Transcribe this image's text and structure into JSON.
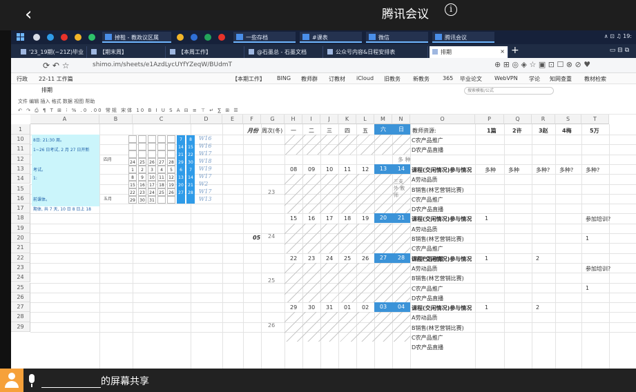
{
  "meeting": {
    "back_glyph": "‹",
    "title": "腾讯会议",
    "info_glyph": "i",
    "sharer_blank": "",
    "share_suffix": "的屏幕共享"
  },
  "taskbar": {
    "apps": [
      {
        "label": "掉鞋 - 教政议区属",
        "color": "#4a8ee8"
      },
      {
        "label": "一些存档",
        "color": "#f0b429"
      },
      {
        "label": "#课表",
        "color": "#f0b429"
      },
      {
        "label": "微信",
        "color": "#2ec26a"
      },
      {
        "label": "腾讯会议",
        "color": "#4a8ee8"
      }
    ],
    "tray_text": "∧ ⊡ ♫ 19:"
  },
  "browser": {
    "tabs": [
      {
        "label": "'23_19期(~21Z)毕业"
      },
      {
        "label": "【期末周】"
      },
      {
        "label": "【本周工作】"
      },
      {
        "label": "@石墨总 - 石墨文档"
      },
      {
        "label": "公众号内容&日程安排表"
      },
      {
        "label": "排期",
        "active": true
      }
    ],
    "url": "shimo.im/sheets/e1AzdLycUYfYZeqW/BUdmT",
    "new_tab_glyph": "+",
    "window_controls": "▭  ⊟  ⧉"
  },
  "bookmarks": [
    {
      "label": "行政"
    },
    {
      "label": "22-11 工作篇"
    },
    {
      "label": "【本期工作】"
    },
    {
      "label": "BING"
    },
    {
      "label": "教师群"
    },
    {
      "label": "订教材"
    },
    {
      "label": "iCloud"
    },
    {
      "label": "旧教务"
    },
    {
      "label": "新教务"
    },
    {
      "label": "365"
    },
    {
      "label": "毕业论文"
    },
    {
      "label": "WebVPN"
    },
    {
      "label": "学论"
    },
    {
      "label": "知网查重"
    },
    {
      "label": "教材检索"
    }
  ],
  "doc": {
    "title": "排期",
    "search_placeholder": "搜索模板/公式",
    "menu_items": "文件  编辑  插入  格式  数据  视图  帮助",
    "format_row": "↶ ↷  ⎙  ¶  T  ⊞  ⁝  %  .0  .00  常规  宋体  10  B  I  U  S  A  ⊟  ≡  ⊤  ↵  ∑  ⊞  ☰"
  },
  "grid": {
    "columns": [
      "A",
      "B",
      "C",
      "D",
      "E",
      "F",
      "G",
      "H",
      "I",
      "J",
      "K",
      "L",
      "M",
      "N",
      "O",
      "P",
      "Q",
      "R",
      "S",
      "T"
    ],
    "row_numbers": [
      "1",
      "10",
      "11",
      "12",
      "13",
      "14",
      "15",
      "16",
      "17",
      "18",
      "19",
      "20",
      "21",
      "22",
      "23",
      "24",
      "25",
      "26",
      "27",
      "28",
      "29"
    ],
    "header_row": {
      "month": "月份",
      "week": "周次(冬)",
      "days": [
        "一",
        "二",
        "三",
        "四",
        "五",
        "六",
        "日"
      ],
      "resource": "教师资源:",
      "p": "1篇",
      "q": "2许",
      "r": "3赵",
      "s": "4梅",
      "t": "5万"
    },
    "month_label": "05",
    "week_numbers": [
      "23",
      "24",
      "25",
      "26"
    ],
    "weeks": [
      {
        "days": [
          "08",
          "09",
          "10",
          "11",
          "12",
          "13",
          "14"
        ]
      },
      {
        "days": [
          "15",
          "16",
          "17",
          "18",
          "19",
          "20",
          "21"
        ]
      },
      {
        "days": [
          "22",
          "23",
          "24",
          "25",
          "26",
          "27",
          "28"
        ]
      },
      {
        "days": [
          "29",
          "30",
          "31",
          "01",
          "02",
          "03",
          "04"
        ]
      }
    ],
    "course_title": "课程(交闲情况)参与情况",
    "course_items": [
      "A劳动品质",
      "B销售(林艺营销比赛)",
      "C农产品推广",
      "D农产品直播"
    ],
    "side_note": "三支 外 教 师",
    "top_note": "多 种",
    "p_values": [
      "多种",
      "1",
      "1",
      "1"
    ],
    "row12": {
      "q": "多种",
      "r": "多种?",
      "s": "多种?",
      "t": "多种?"
    },
    "row17": {
      "t": "参加培训?"
    },
    "row19": {
      "t": "1"
    },
    "row21": {
      "r": "2"
    },
    "row22": {
      "t": "参加培训?"
    },
    "row24": {
      "t": "1"
    },
    "row26": {
      "r": "2"
    },
    "left_notes": [
      "8日: 21:30 周。",
      "1~26 日考试, 2 月 27 日开新",
      "考试。",
      "1:",
      "前课体。",
      "期体, 共 7 天, 10 日 8 日上 18"
    ],
    "calendar_labels": [
      "四月",
      "五月"
    ],
    "handwritten": [
      "W16",
      "W16",
      "W17",
      "W18",
      "W19",
      "W17",
      "W2",
      "W17",
      "W13"
    ],
    "calendar_rows": [
      [
        "",
        "",
        "",
        "",
        "",
        "7",
        "8"
      ],
      [
        "",
        "",
        "",
        "",
        "",
        "14",
        "15"
      ],
      [
        "",
        "",
        "",
        "",
        "",
        "21",
        "22"
      ],
      [
        "24",
        "25",
        "26",
        "27",
        "28",
        "29",
        "30"
      ],
      [
        "1",
        "2",
        "3",
        "4",
        "5",
        "6",
        "7"
      ],
      [
        "8",
        "9",
        "10",
        "11",
        "12",
        "13",
        "14"
      ],
      [
        "15",
        "16",
        "17",
        "18",
        "19",
        "20",
        "21"
      ],
      [
        "22",
        "23",
        "24",
        "25",
        "26",
        "27",
        "28"
      ],
      [
        "29",
        "30",
        "31",
        "",
        "",
        "",
        ""
      ]
    ]
  },
  "colors": {
    "accent_blue": "#3b93d8",
    "cyan_note": "#cbf5fb",
    "taskbar": "#16213a",
    "meeting_bar": "#1e1e1e"
  }
}
